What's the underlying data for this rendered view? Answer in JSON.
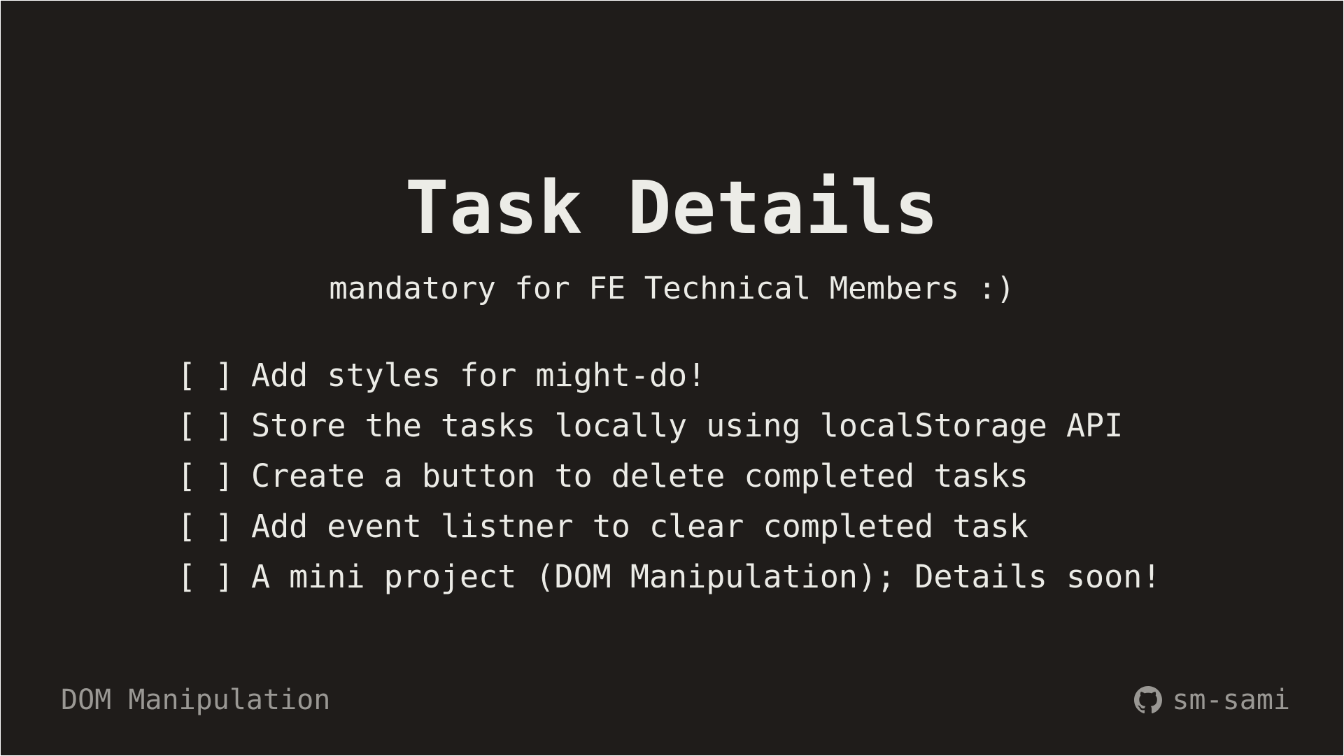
{
  "slide": {
    "title": "Task Details",
    "subtitle": "mandatory for FE Technical Members :)",
    "tasks": [
      {
        "checkbox": "[ ]",
        "text": "Add styles for might-do!"
      },
      {
        "checkbox": "[ ]",
        "text": "Store the tasks locally using localStorage API"
      },
      {
        "checkbox": "[ ]",
        "text": "Create a button to delete completed tasks"
      },
      {
        "checkbox": "[ ]",
        "text": "Add event listner to clear completed task"
      },
      {
        "checkbox": "[ ]",
        "text": "A mini project (DOM Manipulation); Details soon!"
      }
    ]
  },
  "footer": {
    "topic": "DOM Manipulation",
    "github_username": "sm-sami",
    "icon": "github-icon"
  },
  "colors": {
    "background": "#1f1c1a",
    "text": "#ebebe6",
    "muted": "#9a9894"
  }
}
